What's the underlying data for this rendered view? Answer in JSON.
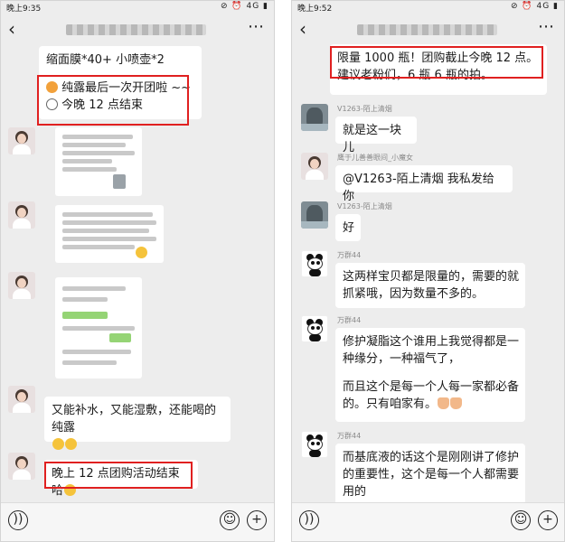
{
  "colors": {
    "chat_bg": "#ededed",
    "bubble": "#ffffff",
    "highlight": "#e02020",
    "text": "#1a1a1a",
    "sender": "#8a8a8a"
  },
  "left": {
    "status_time": "晚上9:35",
    "status_icons": "⊘ ⏰ 4G ▮",
    "back_icon": "‹",
    "more_icon": "⋯",
    "top_bubble": {
      "line1": "缩面膜*40+ 小喷壶*2",
      "line2": "纯露最后一次开团啦 ~~",
      "line3": "今晚 12 点结束"
    },
    "msg_hydrate": "又能补水，又能湿敷，还能喝的纯露",
    "msg_end": "晚上 12 点团购活动结束哈"
  },
  "right": {
    "status_time": "晚上9:52",
    "status_icons": "⊘ ⏰ 4G ▮",
    "back_icon": "‹",
    "more_icon": "⋯",
    "top_bubble": {
      "line1": "限量 1000 瓶！团购截止今晚 12 点。",
      "line2": "建议老粉们，6 瓶 6 瓶的拍。"
    },
    "sender_v1263": "V1263-陌上清烟",
    "msg_this_piece": "就是这一块儿",
    "sender_witch": "鹰于儿善善眼间_小魔女",
    "msg_mention": "@V1263-陌上清烟 我私发给你",
    "sender_v1263_b": "V1263-陌上清烟",
    "msg_ok": "好",
    "sender_wanqun": "万群44",
    "msg_limited": {
      "line1": "这两样宝贝都是限量的，需要的就",
      "line2": "抓紧哦，因为数量不多的。"
    },
    "sender_wanqun_b": "万群44",
    "msg_repair": {
      "line1": "修护凝脂这个谁用上我觉得都是一",
      "line2": "种缘分，一种福气了，",
      "line3": "而且这个是每一个人每一家都必备",
      "line4": "的。只有咱家有。"
    },
    "sender_wanqun_c": "万群44",
    "msg_base": {
      "line1": "而基底液的话这个是刚刚讲了修护",
      "line2": "的重要性，这个是每一个人都需要",
      "line3": "用的"
    }
  }
}
